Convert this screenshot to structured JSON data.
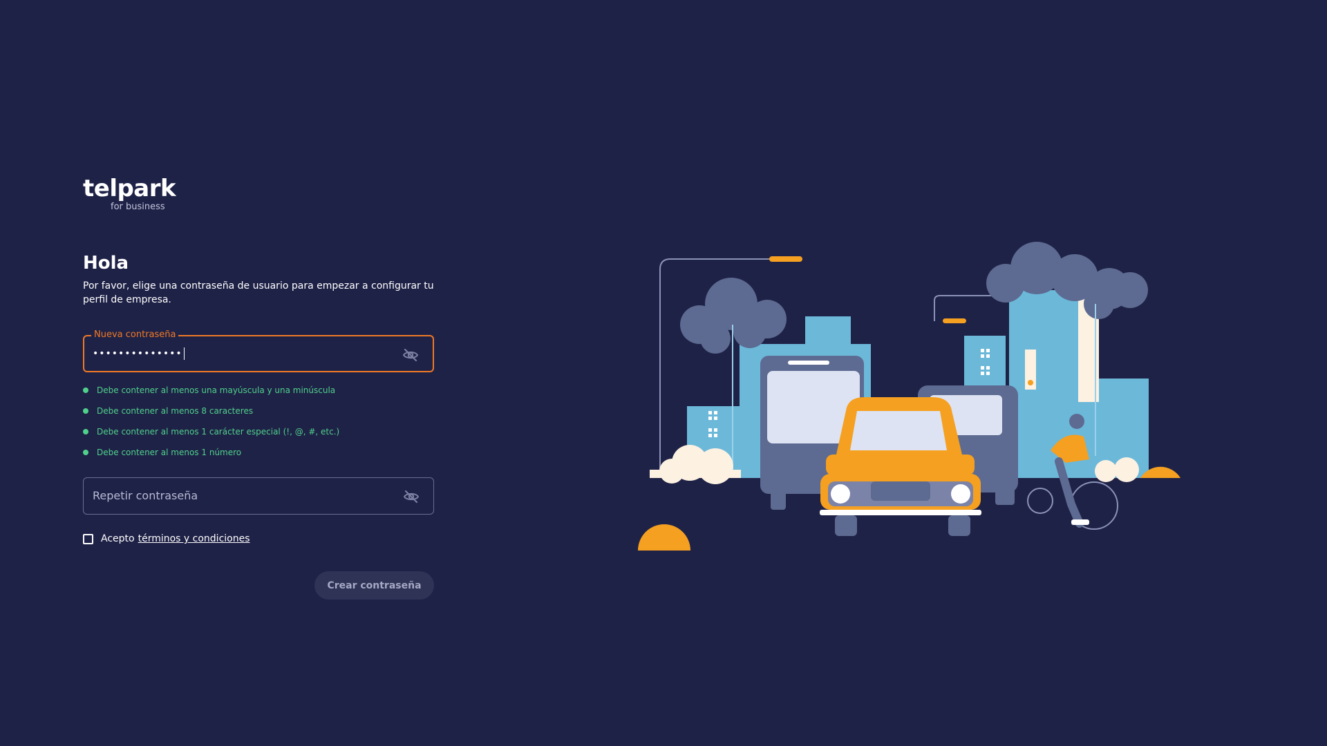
{
  "brand": {
    "name": "telpark",
    "tagline": "for business"
  },
  "heading": "Hola",
  "intro": "Por favor, elige una contraseña de usuario para empezar a configurar tu perfil de empresa.",
  "new_password": {
    "label": "Nueva contraseña",
    "value": "••••••••••••••"
  },
  "rules": [
    "Debe contener al menos una mayúscula y una minúscula",
    "Debe contener al menos 8 caracteres",
    "Debe contener al menos 1 carácter especial (!, @, #, etc.)",
    "Debe contener al menos 1 número"
  ],
  "repeat_password": {
    "placeholder": "Repetir contraseña"
  },
  "terms": {
    "prefix": "Acepto",
    "link": "términos y condiciones",
    "checked": false
  },
  "submit_label": "Crear contraseña",
  "icons": {
    "visibility_toggle": "eye-slash-icon",
    "rule_status": "check-dot-icon"
  },
  "colors": {
    "background": "#1f2247",
    "accent": "#f27a24",
    "success": "#4fd18b",
    "disabled_button": "#2f3356"
  }
}
